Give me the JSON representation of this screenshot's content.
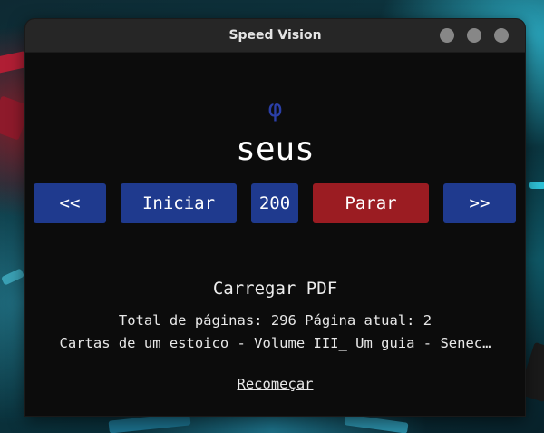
{
  "window": {
    "title": "Speed Vision"
  },
  "reader": {
    "symbol": "φ",
    "current_word": "seus"
  },
  "controls": {
    "prev_label": "<<",
    "start_label": "Iniciar",
    "speed_value": "200",
    "stop_label": "Parar",
    "next_label": ">>"
  },
  "pdf": {
    "load_label": "Carregar PDF",
    "pages_line": "Total de páginas: 296 Página atual: 2",
    "file_name": "Cartas de um estoico - Volume III_ Um guia - Senec…"
  },
  "restart_label": "Recomeçar",
  "colors": {
    "button_blue": "#1f3a8e",
    "button_red": "#9b1c22",
    "accent_symbol": "#2b3fa8",
    "window_bg": "#0c0c0c",
    "titlebar_bg": "#262626"
  }
}
